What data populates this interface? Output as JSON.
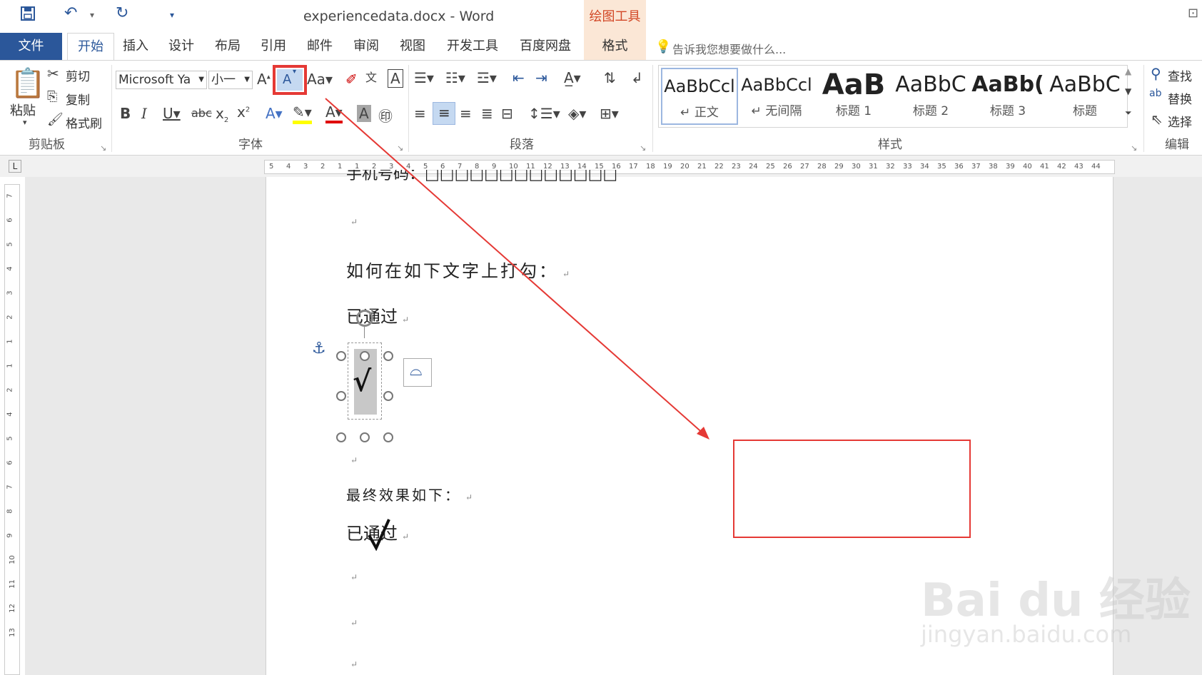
{
  "title_bar": {
    "title": "experiencedata.docx - Word",
    "contextual_header": "绘图工具"
  },
  "tabs": {
    "file": "文件",
    "items": [
      "开始",
      "插入",
      "设计",
      "布局",
      "引用",
      "邮件",
      "审阅",
      "视图",
      "开发工具",
      "百度网盘"
    ],
    "format": "格式",
    "tell_me": "告诉我您想要做什么..."
  },
  "ribbon": {
    "clipboard": {
      "paste": "粘贴",
      "cut": "剪切",
      "copy": "复制",
      "format_painter": "格式刷",
      "label": "剪贴板"
    },
    "font": {
      "font_name": "Microsoft Ya",
      "font_size": "小一",
      "label": "字体"
    },
    "paragraph": {
      "label": "段落"
    },
    "styles": {
      "items": [
        {
          "sample": "AaBbCcl",
          "name": "↵ 正文"
        },
        {
          "sample": "AaBbCcl",
          "name": "↵ 无间隔"
        },
        {
          "sample": "AaB",
          "name": "标题 1"
        },
        {
          "sample": "AaBbC",
          "name": "标题 2"
        },
        {
          "sample": "AaBb(",
          "name": "标题 3"
        },
        {
          "sample": "AaBbC",
          "name": "标题"
        }
      ],
      "label": "样式"
    },
    "editing": {
      "find": "查找",
      "replace": "替换",
      "select": "选择",
      "label": "编辑"
    }
  },
  "ruler": {
    "h_ticks": [
      "5",
      "4",
      "3",
      "2",
      "1",
      "1",
      "2",
      "3",
      "4",
      "5",
      "6",
      "7",
      "8",
      "9",
      "10",
      "11",
      "12",
      "13",
      "14",
      "15",
      "16",
      "17",
      "18",
      "19",
      "20",
      "21",
      "22",
      "23",
      "24",
      "25",
      "26",
      "27",
      "28",
      "29",
      "30",
      "31",
      "32",
      "33",
      "34",
      "35",
      "36",
      "37",
      "38",
      "39",
      "40",
      "41",
      "42",
      "43",
      "44"
    ],
    "v_ticks": [
      "7",
      "6",
      "5",
      "4",
      "3",
      "2",
      "1",
      "1",
      "2",
      "4",
      "5",
      "6",
      "7",
      "8",
      "9",
      "10",
      "11",
      "12",
      "13"
    ]
  },
  "document": {
    "line_top_partial": "手机号码：□□□□□□□□□□□□□",
    "question": "如何在如下文字上打勾：",
    "passed_1": "已通过",
    "check_mark": "√",
    "result_label": "最终效果如下：",
    "passed_2": "已通过"
  },
  "watermark": {
    "text": "Bai du 经验",
    "url": "jingyan.baidu.com"
  },
  "colors": {
    "accent": "#2b579a",
    "contextual": "#d24726",
    "annotation": "#e53935"
  }
}
